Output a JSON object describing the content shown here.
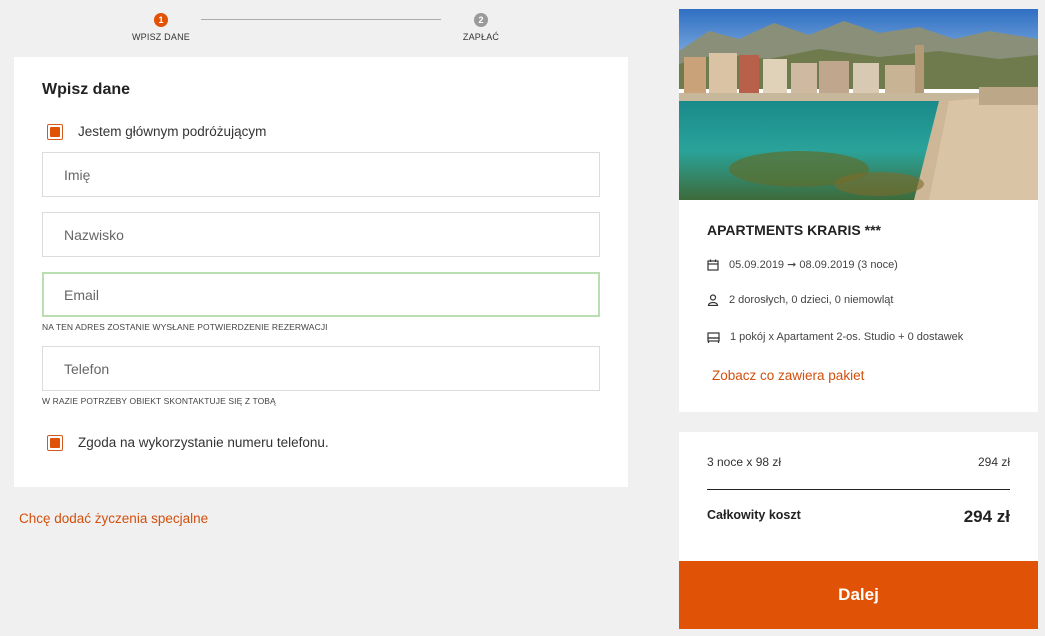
{
  "stepper": {
    "steps": [
      {
        "number": "1",
        "label": "WPISZ DANE",
        "active": true
      },
      {
        "number": "2",
        "label": "ZAPŁAĆ",
        "active": false
      }
    ]
  },
  "form": {
    "title": "Wpisz dane",
    "main_traveler_label": "Jestem głównym podróżującym",
    "first_name_placeholder": "Imię",
    "last_name_placeholder": "Nazwisko",
    "email_placeholder": "Email",
    "email_hint": "NA TEN ADRES ZOSTANIE WYSŁANE POTWIERDZENIE REZERWACJI",
    "phone_placeholder": "Telefon",
    "phone_hint": "W RAZIE POTRZEBY OBIEKT SKONTAKTUJE SIĘ Z TOBĄ",
    "phone_consent_label": "Zgoda na wykorzystanie numeru telefonu."
  },
  "special_requests_link": "Chcę dodać życzenia specjalne",
  "hotel": {
    "name": "APARTMENTS KRARIS ***",
    "dates": "05.09.2019 ➞ 08.09.2019 (3 noce)",
    "guests": "2 dorosłych, 0 dzieci, 0 niemowląt",
    "rooms": "1 pokój x Apartament 2-os. Studio + 0 dostawek",
    "package_link": "Zobacz co zawiera pakiet"
  },
  "price": {
    "line_label": "3 noce x 98 zł",
    "line_value": "294 zł",
    "total_label": "Całkowity koszt",
    "total_value": "294 zł"
  },
  "next_button": "Dalej",
  "colors": {
    "accent": "#e05206",
    "link": "#d24f0c",
    "active_border": "#b9dfb0"
  },
  "icons": {
    "dates": "calendar-icon",
    "guests": "person-icon",
    "rooms": "bed-icon"
  }
}
